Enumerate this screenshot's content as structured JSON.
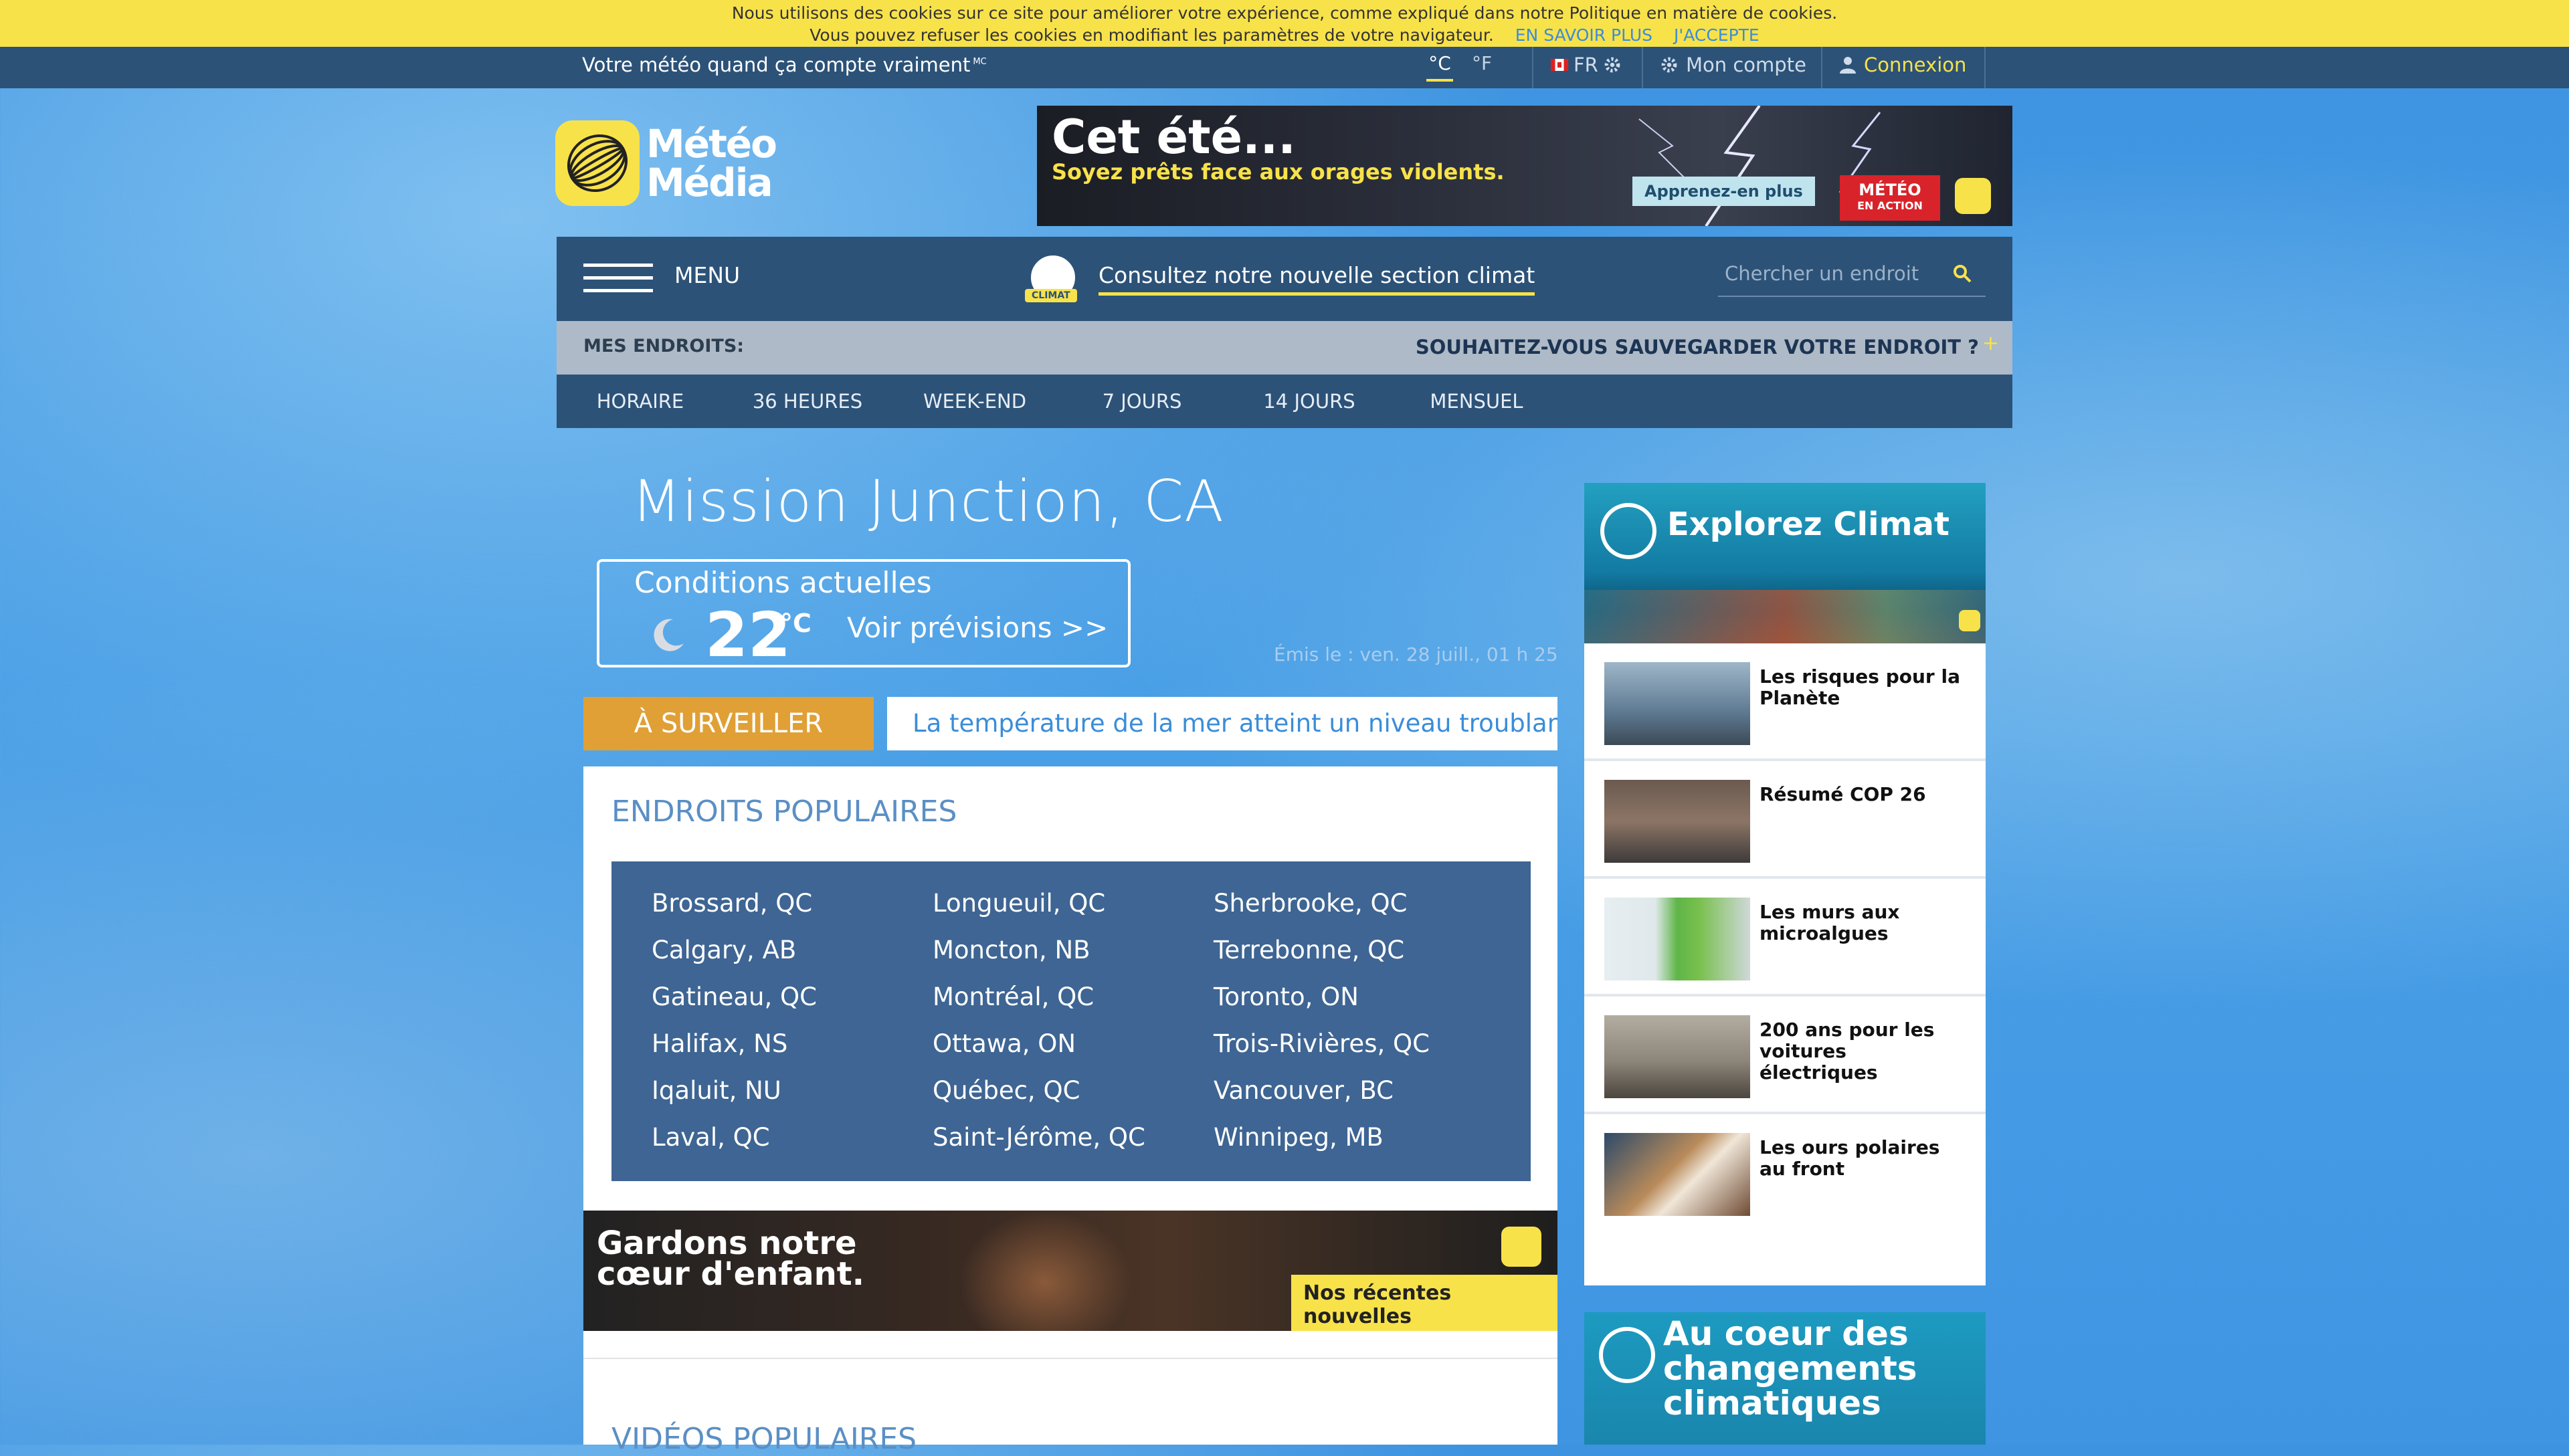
{
  "cookie": {
    "line1": "Nous utilisons des cookies sur ce site pour améliorer votre expérience, comme expliqué dans notre Politique en matière de cookies.",
    "line2": "Vous pouvez refuser les cookies en modifiant les paramètres de votre navigateur.",
    "learn_more": "EN SAVOIR PLUS",
    "accept": "J'ACCEPTE"
  },
  "topbar": {
    "tagline": "Votre météo quand ça compte vraiment",
    "tagline_mark": "MC",
    "unit_c": "°C",
    "unit_f": "°F",
    "lang": "FR",
    "account": "Mon compte",
    "login": "Connexion"
  },
  "logo": {
    "line1": "Météo",
    "line2": "Média"
  },
  "ad_top": {
    "headline": "Cet été...",
    "sub": "Soyez prêts face aux orages violents.",
    "cta": "Apprenez-en plus",
    "badge_line1": "MÉTÉO",
    "badge_line2": "EN ACTION"
  },
  "nav": {
    "menu": "MENU",
    "climat_tag": "CLIMAT",
    "climat_link": "Consultez notre nouvelle section climat",
    "search_placeholder": "Chercher un endroit"
  },
  "mes": {
    "label": "MES ENDROITS:",
    "save_prompt": "SOUHAITEZ-VOUS SAUVEGARDER VOTRE ENDROIT ?",
    "plus": "+"
  },
  "tabs": [
    "HORAIRE",
    "36 HEURES",
    "WEEK-END",
    "7 JOURS",
    "14 JOURS",
    "MENSUEL"
  ],
  "location": {
    "city": "Mission Junction, CA",
    "conditions_label": "Conditions actuelles",
    "temperature": "22",
    "unit": "°C",
    "forecast_link": "Voir prévisions >>",
    "issued": "Émis le : ven. 28 juill., 01 h 25"
  },
  "watch": {
    "label": "À SURVEILLER",
    "headline": "La température de la mer atteint un niveau troublant"
  },
  "popular": {
    "title": "ENDROITS POPULAIRES",
    "columns": [
      [
        "Brossard, QC",
        "Calgary, AB",
        "Gatineau, QC",
        "Halifax, NS",
        "Iqaluit, NU",
        "Laval, QC"
      ],
      [
        "Longueuil, QC",
        "Moncton, NB",
        "Montréal, QC",
        "Ottawa, ON",
        "Québec, QC",
        "Saint-Jérôme, QC"
      ],
      [
        "Sherbrooke, QC",
        "Terrebonne, QC",
        "Toronto, ON",
        "Trois-Rivières, QC",
        "Vancouver, BC",
        "Winnipeg, MB"
      ]
    ],
    "videos_title": "VIDÉOS POPULAIRES"
  },
  "ad_kid": {
    "line1": "Gardons notre",
    "line2": "cœur d'enfant.",
    "cta": "Nos récentes nouvelles"
  },
  "sidebar": {
    "hero_title": "Explorez Climat",
    "articles": [
      "Les risques pour la Planète",
      "Résumé COP 26",
      "Les murs aux microalgues",
      "200 ans pour les voitures électriques",
      "Les ours polaires au front"
    ],
    "change_title": "Au coeur des changements climatiques"
  },
  "colors": {
    "topbar": "#2c5278",
    "accent_yellow": "#f8e24a",
    "watch_orange": "#e0a036",
    "popular_box": "#3e6593",
    "link_blue": "#3a8dd8"
  }
}
